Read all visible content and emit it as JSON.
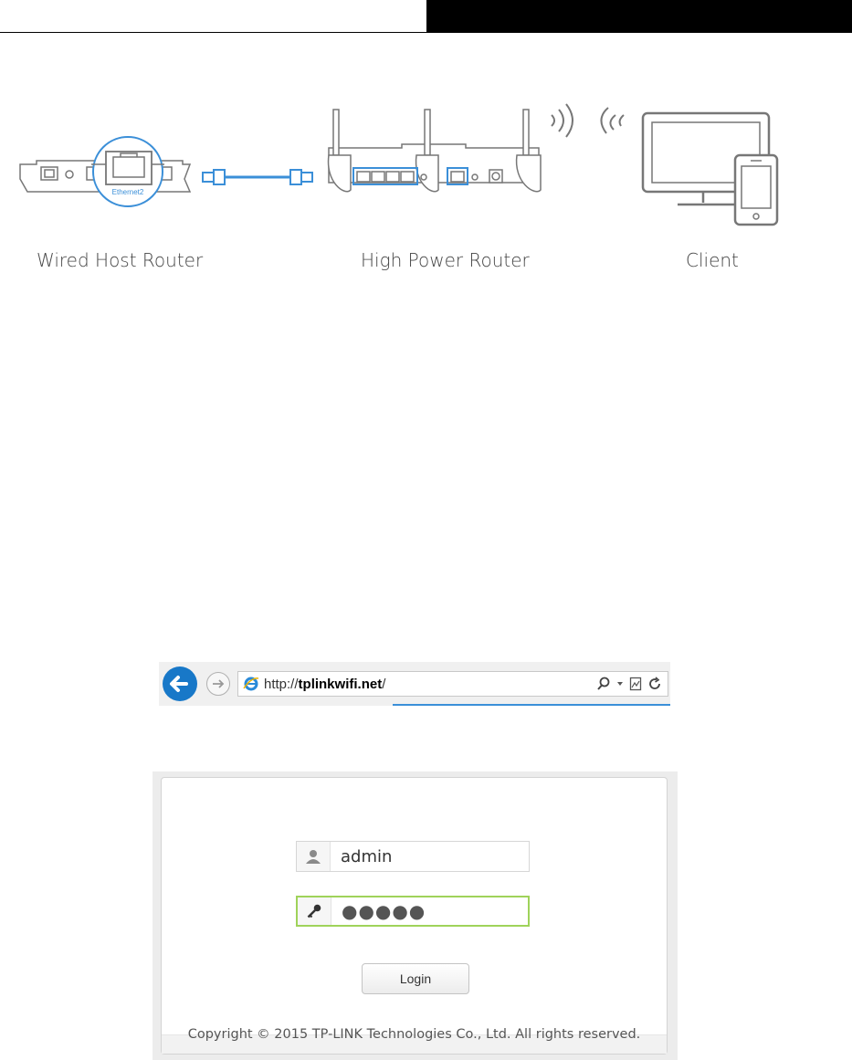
{
  "diagram": {
    "port_label": "Ethernet2",
    "labels": {
      "wired_host_router": "Wired Host Router",
      "high_power_router": "High Power Router",
      "client": "Client"
    }
  },
  "browser": {
    "url_prefix": "http://",
    "url_host": "tplinkwifi.net",
    "url_suffix": "/",
    "accent": "#1878c8"
  },
  "login": {
    "username": "admin",
    "password_mask": "●●●●●",
    "button_label": "Login",
    "copyright": "Copyright © 2015 TP-LINK Technologies Co., Ltd. All rights reserved.",
    "focus_color": "#9fd35a"
  }
}
